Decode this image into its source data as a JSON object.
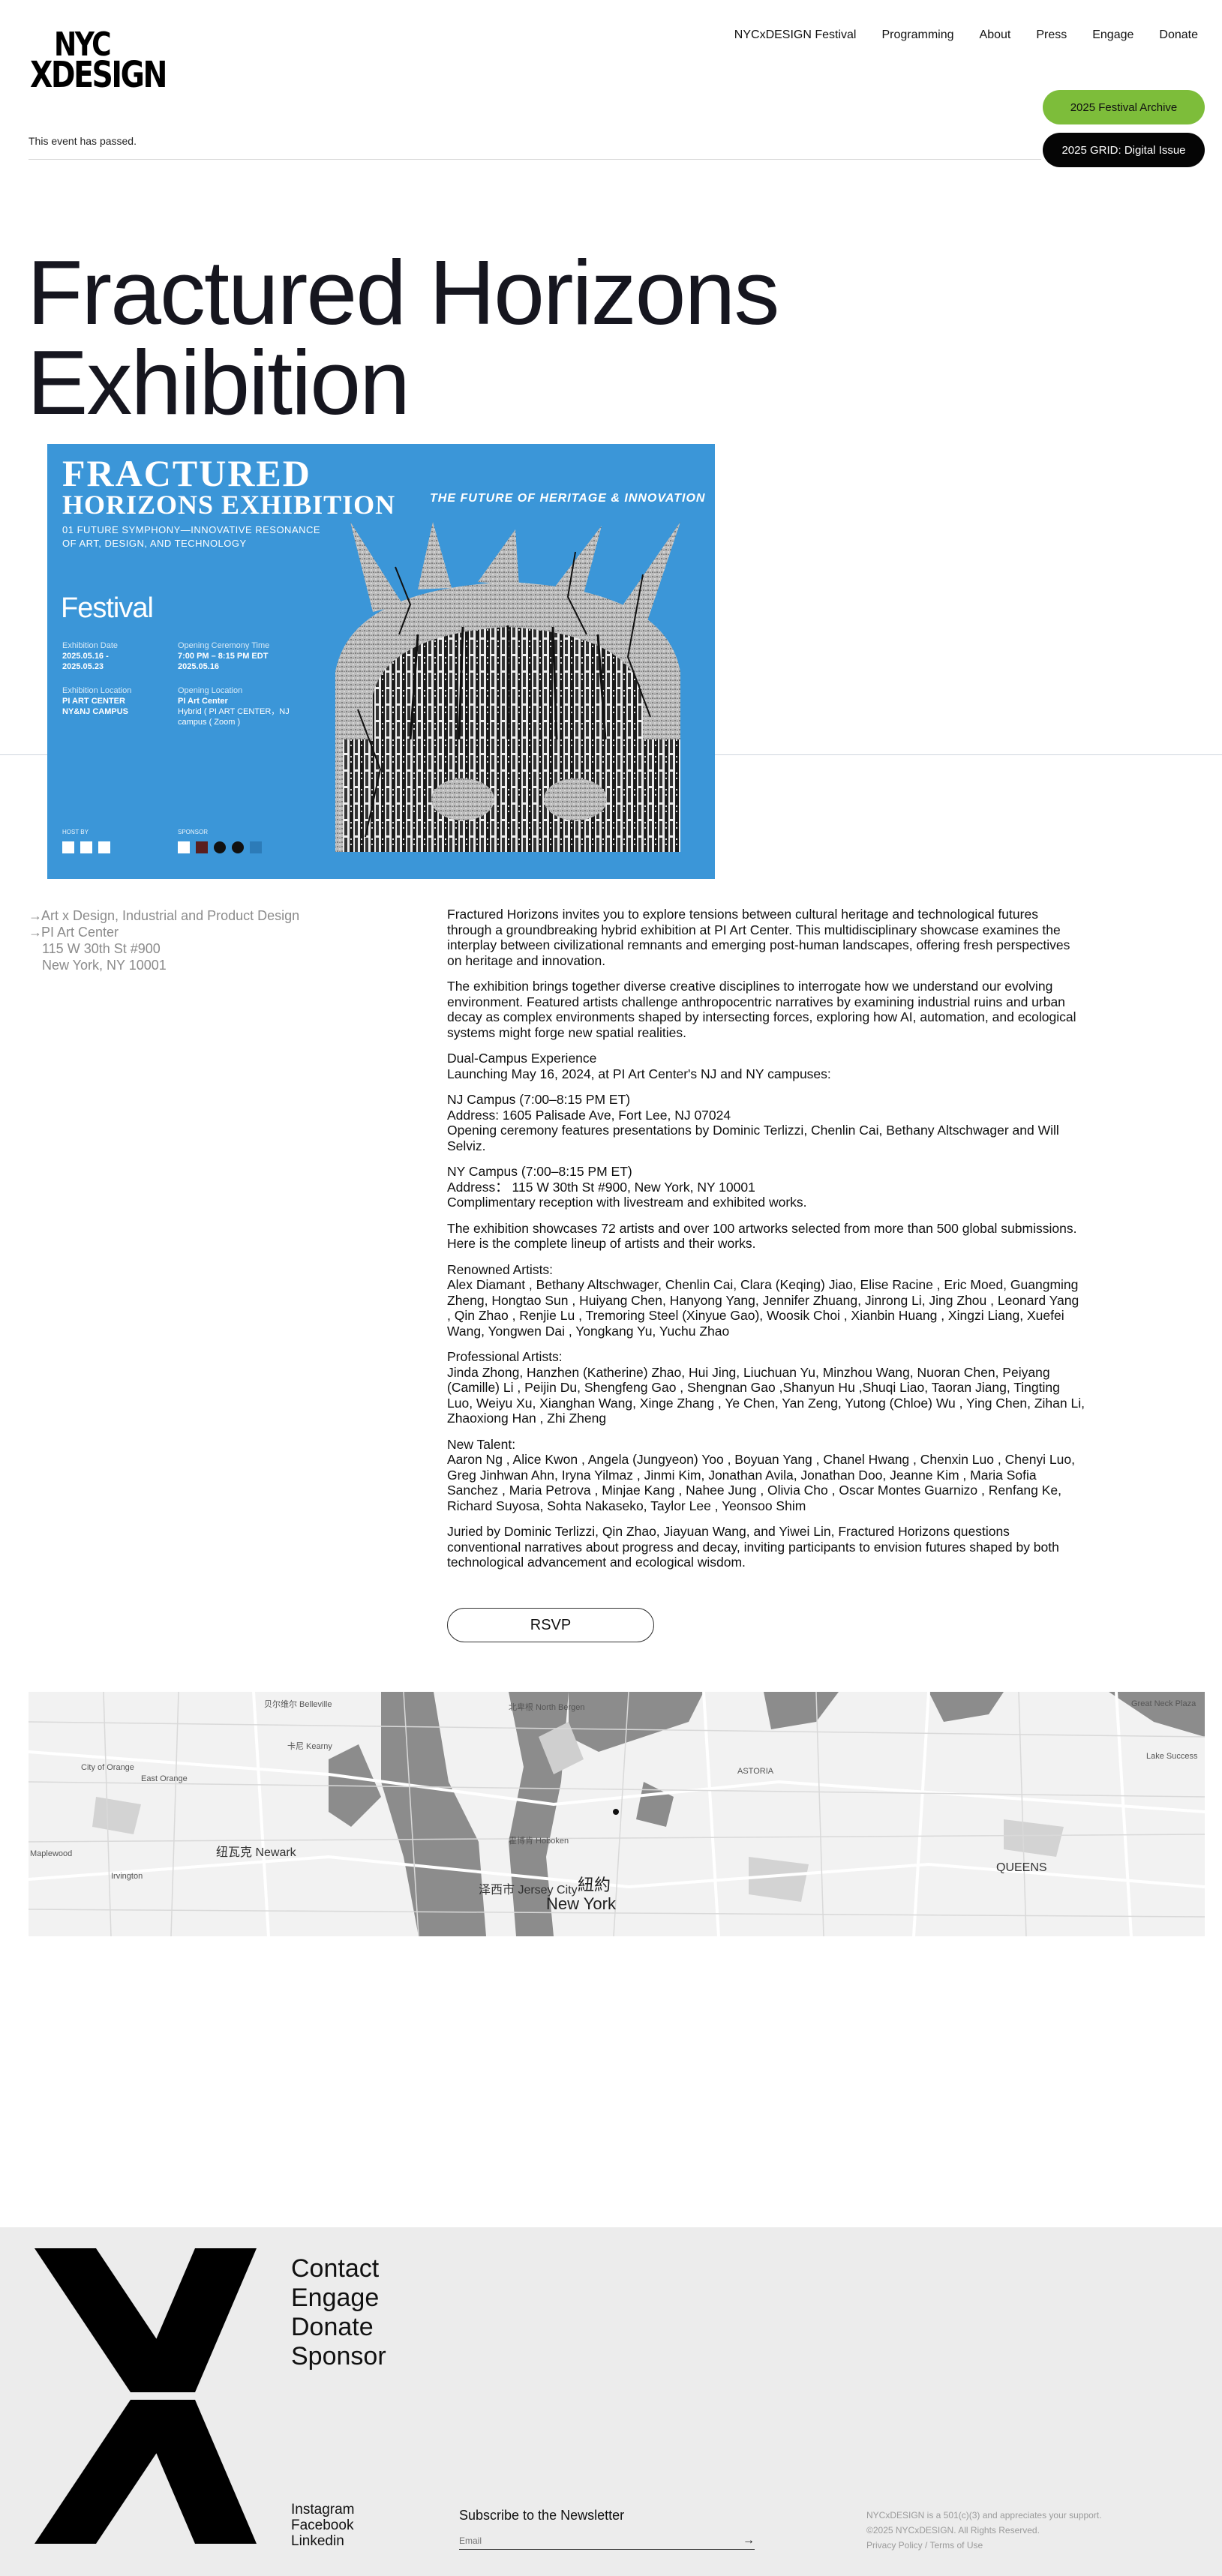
{
  "header": {
    "logo_line1": "NYC",
    "logo_line2": "XDESIGN",
    "nav": [
      "NYCxDESIGN Festival",
      "Programming",
      "About",
      "Press",
      "Engage",
      "Donate"
    ],
    "archive_button": "2025 Festival Archive",
    "grid_button": "2025 GRID: Digital Issue",
    "event_passed": "This event has passed."
  },
  "event": {
    "title_line1": "Fractured Horizons",
    "title_line2": "Exhibition"
  },
  "poster": {
    "title1": "FRACTURED",
    "title2": "HORIZONS EXHIBITION",
    "tagline": "THE FUTURE OF HERITAGE & INNOVATION",
    "subtitle1": "01 FUTURE SYMPHONY—INNOVATIVE RESONANCE",
    "subtitle2": "OF ART, DESIGN, AND TECHNOLOGY",
    "festival": "Festival",
    "exhibition_date_cap": "Exhibition Date",
    "exhibition_date": "2025.05.16 -",
    "exhibition_date2": "2025.05.23",
    "ceremony_cap": "Opening Ceremony Time",
    "ceremony_time": "7:00 PM – 8:15 PM EDT",
    "ceremony_date": "2025.05.16",
    "location_cap": "Exhibition Location",
    "location1": "PI ART CENTER",
    "location2": "NY&NJ CAMPUS",
    "opening_loc_cap": "Opening Location",
    "opening_loc": "PI Art Center",
    "opening_loc2": "Hybrid ( PI ART CENTER，NJ",
    "opening_loc3": "campus ( Zoom )",
    "host_by": "HOST BY",
    "sponsor": "SPONSOR"
  },
  "details": {
    "organizer": "Art x Design, Industrial and Product Design",
    "venue": "PI Art Center",
    "address1": "115 W 30th St #900",
    "address2": "New York, NY 10001"
  },
  "description": {
    "p1": "Fractured Horizons invites you to explore tensions between cultural heritage and technological futures through a groundbreaking hybrid exhibition at PI Art Center. This multidisciplinary showcase examines the interplay between civilizational remnants and emerging post-human landscapes, offering fresh perspectives on heritage and innovation.",
    "p2": "The exhibition brings together diverse creative disciplines to interrogate how we understand our evolving environment. Featured artists challenge anthropocentric narratives by examining industrial ruins and urban decay as complex environments shaped by intersecting forces, exploring how AI, automation, and ecological systems might forge new spatial realities.",
    "p3a": "Dual-Campus Experience",
    "p3b": "Launching May 16, 2024, at PI Art Center's NJ and NY campuses:",
    "p4a": "NJ Campus (7:00–8:15 PM ET)",
    "p4b": "Address: 1605 Palisade Ave, Fort Lee, NJ 07024",
    "p4c": "Opening ceremony features presentations by Dominic Terlizzi, Chenlin Cai, Bethany Altschwager and Will Selviz.",
    "p5a": "NY Campus (7:00–8:15 PM ET)",
    "p5b": "Address： 115 W 30th St #900, New York, NY 10001",
    "p5c": "Complimentary reception with livestream and exhibited works.",
    "p6": "The exhibition showcases 72 artists and over 100 artworks selected from more than 500 global submissions. Here is the complete lineup of artists and their works.",
    "renowned_head": "Renowned Artists:",
    "renowned": "Alex Diamant , Bethany Altschwager, Chenlin Cai, Clara (Keqing) Jiao, Elise Racine , Eric Moed, Guangming Zheng, Hongtao Sun , Huiyang Chen, Hanyong Yang, Jennifer Zhuang, Jinrong Li, Jing Zhou , Leonard Yang , Qin Zhao , Renjie Lu , Tremoring Steel (Xinyue Gao), Woosik Choi , Xianbin Huang , Xingzi Liang, Xuefei Wang, Yongwen Dai , Yongkang Yu, Yuchu Zhao",
    "pro_head": "Professional Artists:",
    "pro": "Jinda Zhong, Hanzhen (Katherine) Zhao, Hui Jing, Liuchuan Yu, Minzhou Wang, Nuoran Chen, Peiyang (Camille) Li , Peijin Du, Shengfeng Gao , Shengnan Gao ,Shanyun Hu ,Shuqi Liao, Taoran Jiang, Tingting Luo, Weiyu Xu, Xianghan Wang, Xinge Zhang , Ye Chen, Yan Zeng, Yutong (Chloe) Wu , Ying Chen, Zihan Li, Zhaoxiong Han , Zhi Zheng",
    "new_head": "New Talent:",
    "new": "Aaron Ng , Alice Kwon , Angela (Jungyeon) Yoo , Boyuan Yang , Chanel Hwang , Chenxin Luo , Chenyi Luo, Greg Jinhwan Ahn, Iryna Yilmaz , Jinmi Kim, Jonathan Avila, Jonathan Doo, Jeanne Kim , Maria Sofia Sanchez , Maria Petrova , Minjae Kang , Nahee Jung , Olivia Cho , Oscar Montes Guarnizo , Renfang Ke, Richard Suyosa, Sohta Nakaseko, Taylor Lee , Yeonsoo Shim",
    "p_last": "Juried by Dominic Terlizzi, Qin Zhao, Jiayuan Wang, and Yiwei Lin, Fractured Horizons questions conventional narratives about progress and decay, inviting participants to envision futures shaped by both technological advancement and ecological wisdom.",
    "rsvp": "RSVP"
  },
  "map": {
    "labels": [
      "贝尔维尔 Belleville",
      "北卑根 North Bergen",
      "卡尼 Kearny",
      "纽瓦克 Newark",
      "霍博肯 Hoboken",
      "泽西市 Jersey City",
      "紐約",
      "New York",
      "ASTORIA",
      "QUEENS",
      "Great Neck Plaza",
      "Lake Success",
      "East Orange",
      "City of Orange",
      "Irvington",
      "Maplewood"
    ]
  },
  "footer": {
    "links": [
      "Contact",
      "Engage",
      "Donate",
      "Sponsor"
    ],
    "social": [
      "Instagram",
      "Facebook",
      "Linkedin"
    ],
    "newsletter_title": "Subscribe to the Newsletter",
    "email_placeholder": "Email",
    "legal1": "NYCxDESIGN is a 501(c)(3) and appreciates your support.",
    "legal2": "©2025 NYCxDESIGN. All Rights Reserved.",
    "privacy": "Privacy Policy",
    "sep": " / ",
    "terms": "Terms of Use"
  },
  "colors": {
    "accent_green": "#7dbd3a",
    "poster_blue": "#3b96d8",
    "footer_bg": "#ececec"
  }
}
